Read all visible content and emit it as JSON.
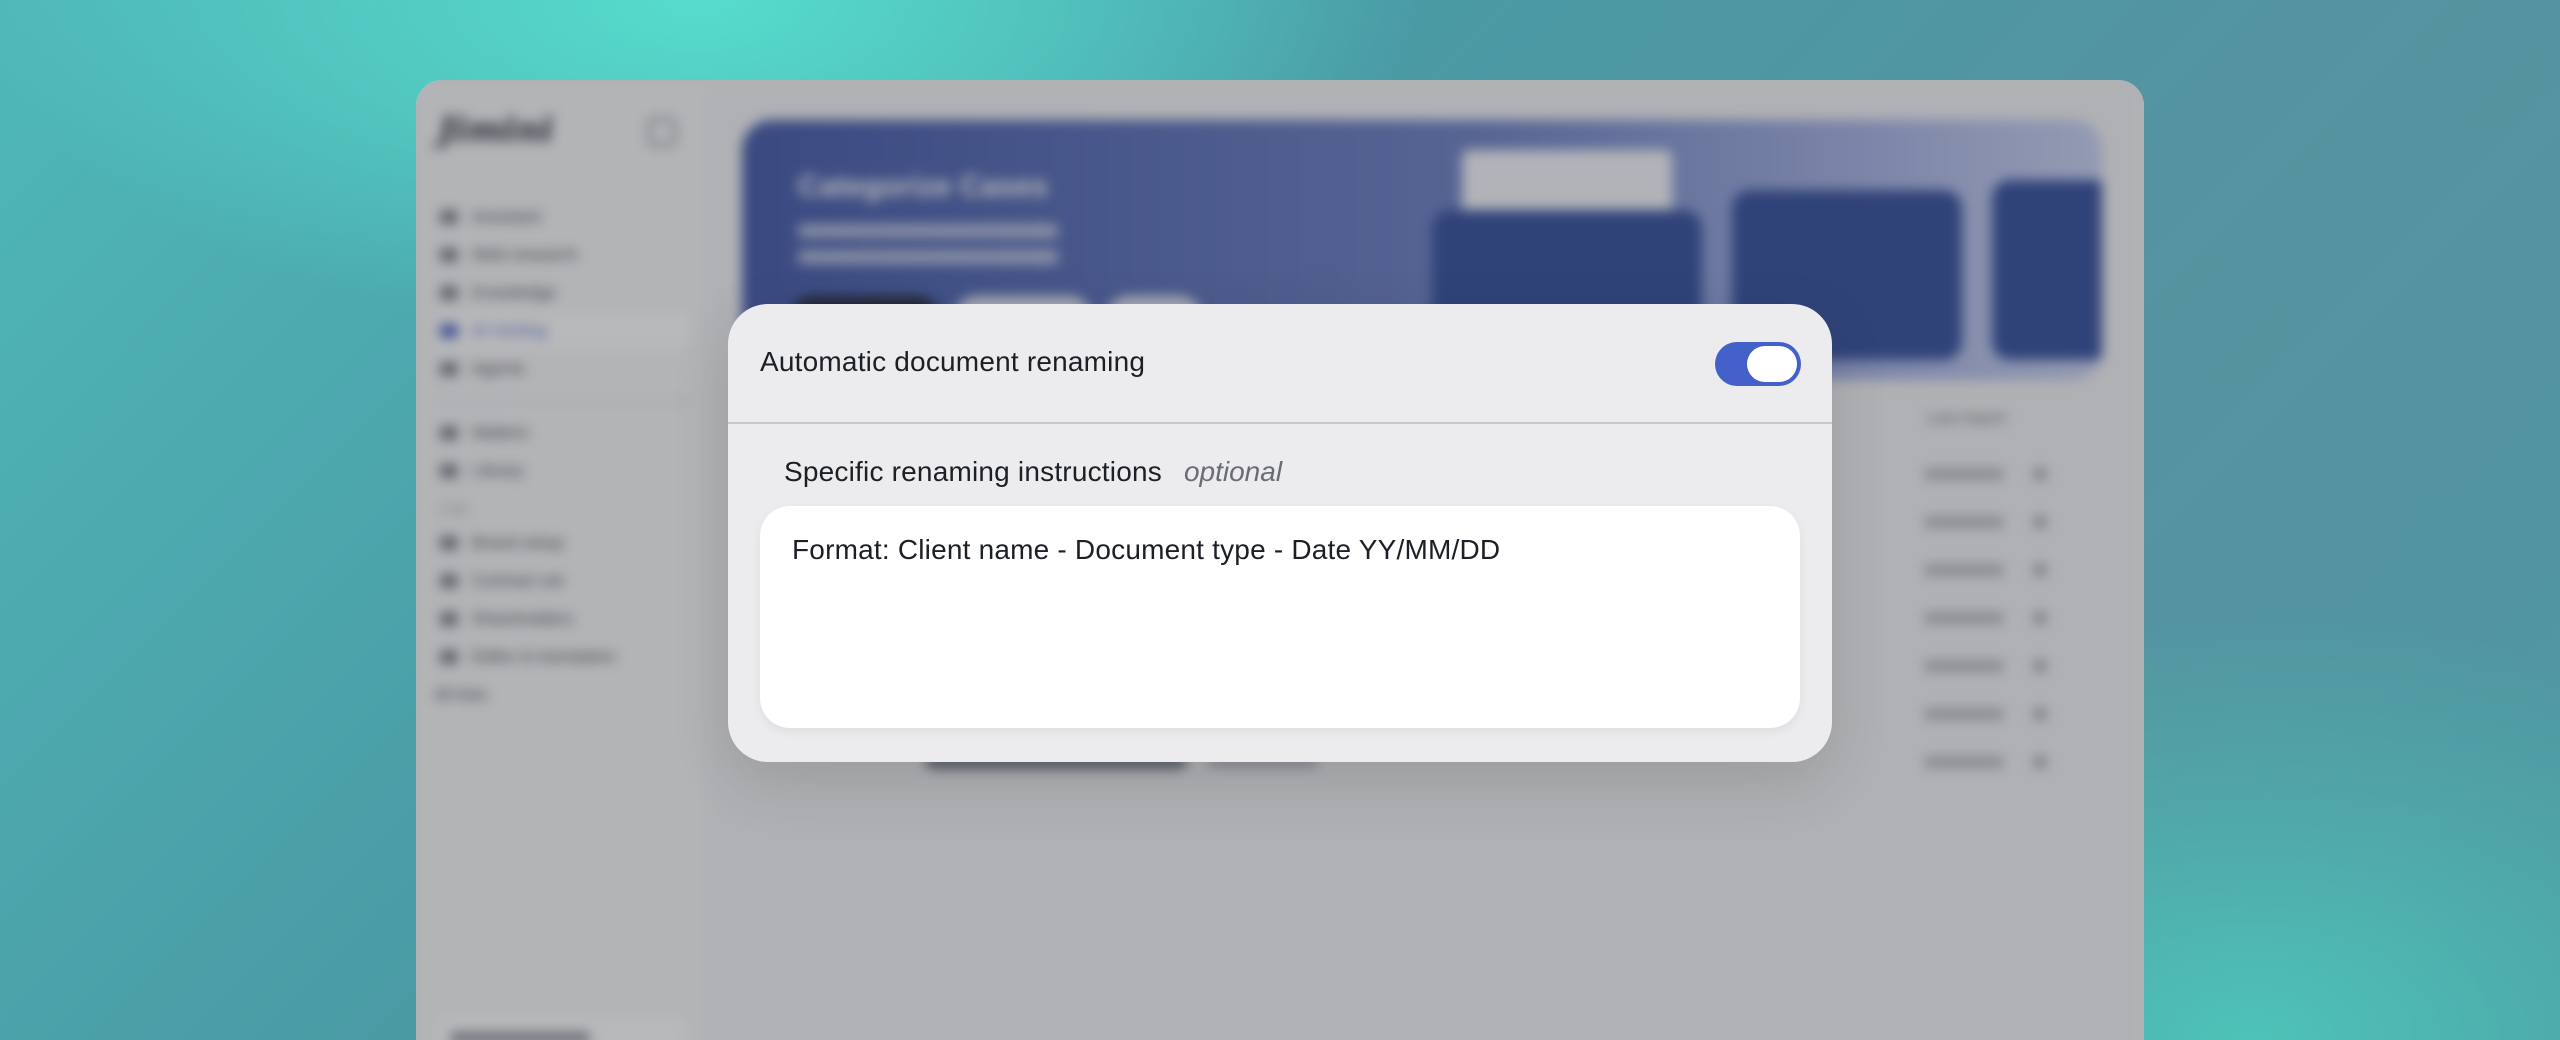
{
  "app": {
    "logo_text": "Jimini",
    "sidebar": {
      "nav": [
        {
          "label": "Assistant",
          "active": false
        },
        {
          "label": "Web research",
          "active": false
        },
        {
          "label": "Knowledge",
          "active": false
        },
        {
          "label": "AI Sorting",
          "active": true
        },
        {
          "label": "Agents",
          "active": false
        }
      ],
      "secondary": [
        {
          "label": "Matters"
        },
        {
          "label": "Library"
        }
      ],
      "section_title": "Lists",
      "lists": [
        {
          "label": "Brand setup"
        },
        {
          "label": "Contract set"
        },
        {
          "label": "Shareholders"
        },
        {
          "label": "Editor & translation"
        },
        {
          "label": "All lists"
        }
      ]
    },
    "hero": {
      "title": "Categorize Cases"
    },
    "column_header": "Last import"
  },
  "modal": {
    "toggle_label": "Automatic document renaming",
    "toggle_on": true,
    "toggle_color": "#4361c9",
    "instructions_label": "Specific renaming instructions",
    "instructions_optional": "optional",
    "instructions_value": "Format: Client name - Document type - Date YY/MM/DD"
  }
}
